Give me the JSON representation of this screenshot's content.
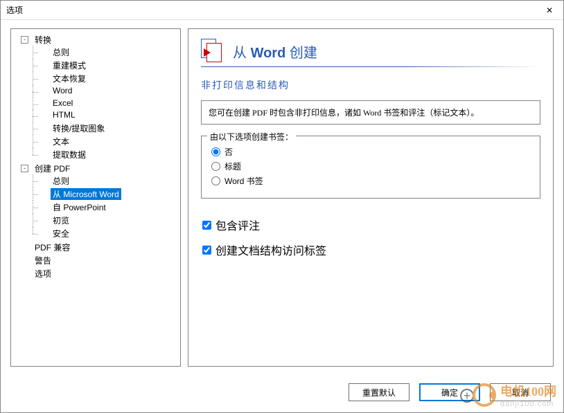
{
  "window": {
    "title": "选项"
  },
  "tree": {
    "nodes": [
      {
        "label": "转换",
        "expander": "-",
        "children": [
          {
            "label": "总则"
          },
          {
            "label": "重建模式"
          },
          {
            "label": "文本恢复"
          },
          {
            "label": "Word"
          },
          {
            "label": "Excel"
          },
          {
            "label": "HTML"
          },
          {
            "label": "转换/提取图象"
          },
          {
            "label": "文本"
          },
          {
            "label": "提取数据"
          }
        ]
      },
      {
        "label": "创建 PDF",
        "expander": "-",
        "children": [
          {
            "label": "总则"
          },
          {
            "label": "从 Microsoft Word",
            "selected": true
          },
          {
            "label": "自 PowerPoint"
          },
          {
            "label": "初览"
          },
          {
            "label": "安全"
          }
        ]
      },
      {
        "label": "PDF 兼容"
      },
      {
        "label": "警告"
      },
      {
        "label": "选项"
      }
    ]
  },
  "content": {
    "heading_prefix": "从 ",
    "heading_bold": "Word",
    "heading_suffix": " 创建",
    "section_title": "非打印信息和结构",
    "info_text": "您可在创建 PDF 时包含非打印信息，诸如 Word 书签和评注（标记文本）。",
    "fieldset_legend": "由以下选项创建书签：",
    "radios": [
      {
        "label": "否",
        "checked": true
      },
      {
        "label": "标题",
        "checked": false
      },
      {
        "label": "Word 书签",
        "checked": false
      }
    ],
    "checks": [
      {
        "label": "包含评注",
        "checked": true
      },
      {
        "label": "创建文档结构访问标签",
        "checked": true
      }
    ]
  },
  "footer": {
    "reset": "重置默认",
    "ok": "确定",
    "cancel": "取消"
  },
  "watermark": {
    "brand": "电机100网",
    "sub": "danji100.com"
  }
}
